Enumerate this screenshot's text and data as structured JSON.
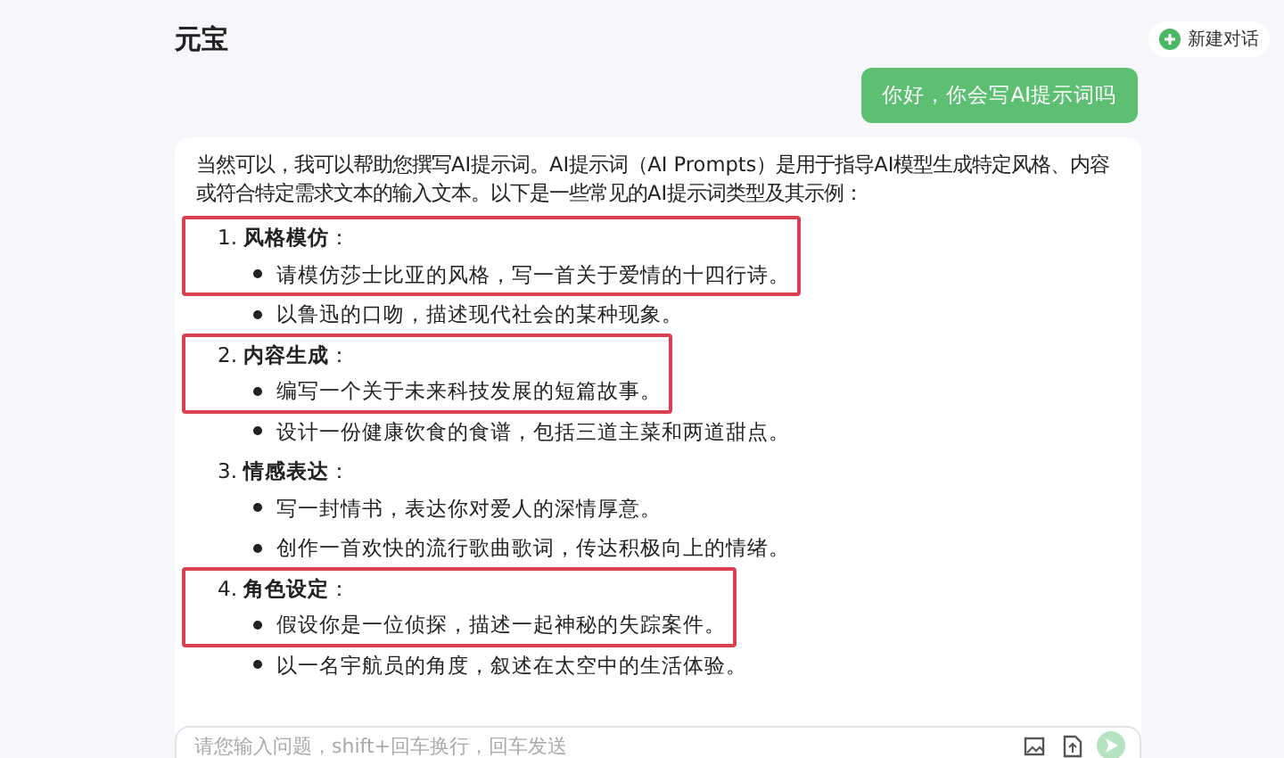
{
  "header": {
    "title": "元宝",
    "new_chat": "新建对话"
  },
  "user_message": "你好，你会写AI提示词吗",
  "answer": {
    "intro": "当然可以，我可以帮助您撰写AI提示词。AI提示词（AI Prompts）是用于指导AI模型生成特定风格、内容或符合特定需求文本的输入文本。以下是一些常见的AI提示词类型及其示例：",
    "sections": [
      {
        "number": "1.",
        "heading": "风格模仿",
        "colon": "：",
        "highlighted": true,
        "bullets": [
          "请模仿莎士比亚的风格，写一首关于爱情的十四行诗。",
          "以鲁迅的口吻，描述现代社会的某种现象。"
        ]
      },
      {
        "number": "2.",
        "heading": "内容生成",
        "colon": "：",
        "highlighted": true,
        "bullets": [
          "编写一个关于未来科技发展的短篇故事。",
          "设计一份健康饮食的食谱，包括三道主菜和两道甜点。"
        ]
      },
      {
        "number": "3.",
        "heading": "情感表达",
        "colon": "：",
        "highlighted": false,
        "bullets": [
          "写一封情书，表达你对爱人的深情厚意。",
          "创作一首欢快的流行歌曲歌词，传达积极向上的情绪。"
        ]
      },
      {
        "number": "4.",
        "heading": "角色设定",
        "colon": "：",
        "highlighted": true,
        "bullets": [
          "假设你是一位侦探，描述一起神秘的失踪案件。",
          "以一名宇航员的角度，叙述在太空中的生活体验。"
        ]
      }
    ]
  },
  "input": {
    "placeholder": "请您输入问题，shift+回车换行，回车发送"
  }
}
